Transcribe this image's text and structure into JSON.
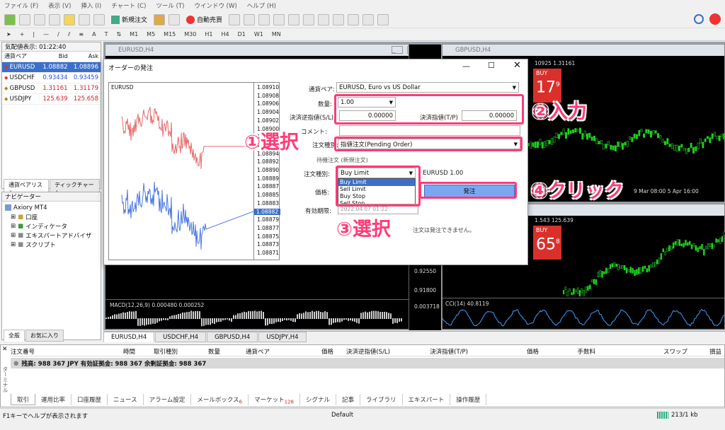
{
  "menu": [
    "ファイル (F)",
    "表示 (V)",
    "挿入 (I)",
    "チャート (C)",
    "ツール (T)",
    "ウインドウ (W)",
    "ヘルプ (H)"
  ],
  "toolbar": {
    "new_order": "新規注文",
    "autotrade": "自動売買"
  },
  "timeframes": [
    "M1",
    "M5",
    "M15",
    "M30",
    "H1",
    "H4",
    "D1",
    "W1",
    "MN"
  ],
  "market_watch": {
    "title": "気配値表示: 01:22:40",
    "headers": [
      "通貨ペア",
      "Bid",
      "Ask"
    ],
    "rows": [
      [
        "EURUSD",
        "1.08882",
        "1.08896"
      ],
      [
        "USDCHF",
        "0.93434",
        "0.93459"
      ],
      [
        "GBPUSD",
        "1.31161",
        "1.31179"
      ],
      [
        "USDJPY",
        "125.639",
        "125.658"
      ]
    ],
    "tabs": [
      "通貨ペアリスト",
      "ティックチャート"
    ]
  },
  "navigator": {
    "title": "ナビゲーター",
    "root": "Axiory MT4",
    "items": [
      "口座",
      "インディケータ",
      "エキスパートアドバイザ",
      "スクリプト"
    ],
    "tabs": [
      "全般",
      "お気に入り"
    ]
  },
  "charts": {
    "eurusd_title": "EURUSD,H4",
    "gbpusd_title": "GBPUSD,H4",
    "gbp_header": "10925 1.31161",
    "jpy_header": "1.543 125.639",
    "buy": "BUY",
    "buy_big1": "17",
    "buy_sup1": "9",
    "buy_big2": "65",
    "buy_sup2": "8",
    "eur_prices": [
      "0.92550",
      "0.91800",
      "0.003718"
    ],
    "macd": "MACD(12,26,9) 0.000480 0.000252",
    "cci": "CCI(14) 40.8119",
    "dates": "9 Mar 08:00 5 Apr 16:00",
    "tabs": [
      "EURUSD,H4",
      "USDCHF,H4",
      "GBPUSD,H4",
      "USDJPY,H4"
    ]
  },
  "dialog": {
    "title": "オーダーの発注",
    "chart_symbol": "EURUSD",
    "prices": [
      "1.08910",
      "1.08908",
      "1.08906",
      "1.08904",
      "1.08902",
      "1.08900",
      "1.08898",
      "1.08896",
      "1.08894",
      "1.08892",
      "1.08890",
      "1.08889",
      "1.08887",
      "1.08885",
      "1.08883",
      "1.08882",
      "1.08879",
      "1.08877",
      "1.08875",
      "1.08873",
      "1.08871"
    ],
    "symbol_label": "通貨ペア:",
    "symbol_value": "EURUSD, Euro vs US Dollar",
    "volume_label": "数量:",
    "volume_value": "1.00",
    "sl_label": "決済逆指値(S/L)",
    "sl_value": "0.00000",
    "tp_label": "決済指値(T/P)",
    "tp_value": "0.00000",
    "comment_label": "コメント:",
    "type_label": "注文種別:",
    "type_value": "指値注文(Pending Order)",
    "pending_title": "待機注文 (新規注文)",
    "order_type_label": "注文種別:",
    "order_type_value": "Buy Limit",
    "order_symbol": "EURUSD 1.00",
    "order_options": [
      "Buy Limit",
      "Sell Limit",
      "Buy Stop",
      "Sell Stop"
    ],
    "price_label": "価格:",
    "expiry_label": "有効期限:",
    "expiry_value": "2022.04.07 01:22",
    "place_button": "発注",
    "note": "注文は発注できません。"
  },
  "annotations": [
    "①選択",
    "②入力",
    "③選択",
    "④クリック"
  ],
  "terminal": {
    "headers": [
      "注文番号",
      "時間",
      "取引種別",
      "数量",
      "通貨ペア",
      "価格",
      "決済逆指値(S/L)",
      "決済指値(T/P)",
      "価格",
      "手数料",
      "スワップ",
      "損益"
    ],
    "balance": "残高: 988 367 JPY  有効証拠金: 988 367  余剰証拠金: 988 367",
    "side_label": "ターミナル",
    "tabs": [
      {
        "label": "取引"
      },
      {
        "label": "運用比率"
      },
      {
        "label": "口座履歴"
      },
      {
        "label": "ニュース"
      },
      {
        "label": "アラーム設定"
      },
      {
        "label": "メールボックス",
        "badge": "6"
      },
      {
        "label": "マーケット",
        "badge": "128"
      },
      {
        "label": "シグナル"
      },
      {
        "label": "記事"
      },
      {
        "label": "ライブラリ"
      },
      {
        "label": "エキスパート"
      },
      {
        "label": "操作履歴"
      }
    ]
  },
  "status": {
    "help": "F1キーでヘルプが表示されます",
    "profile": "Default",
    "traffic": "213/1 kb"
  }
}
